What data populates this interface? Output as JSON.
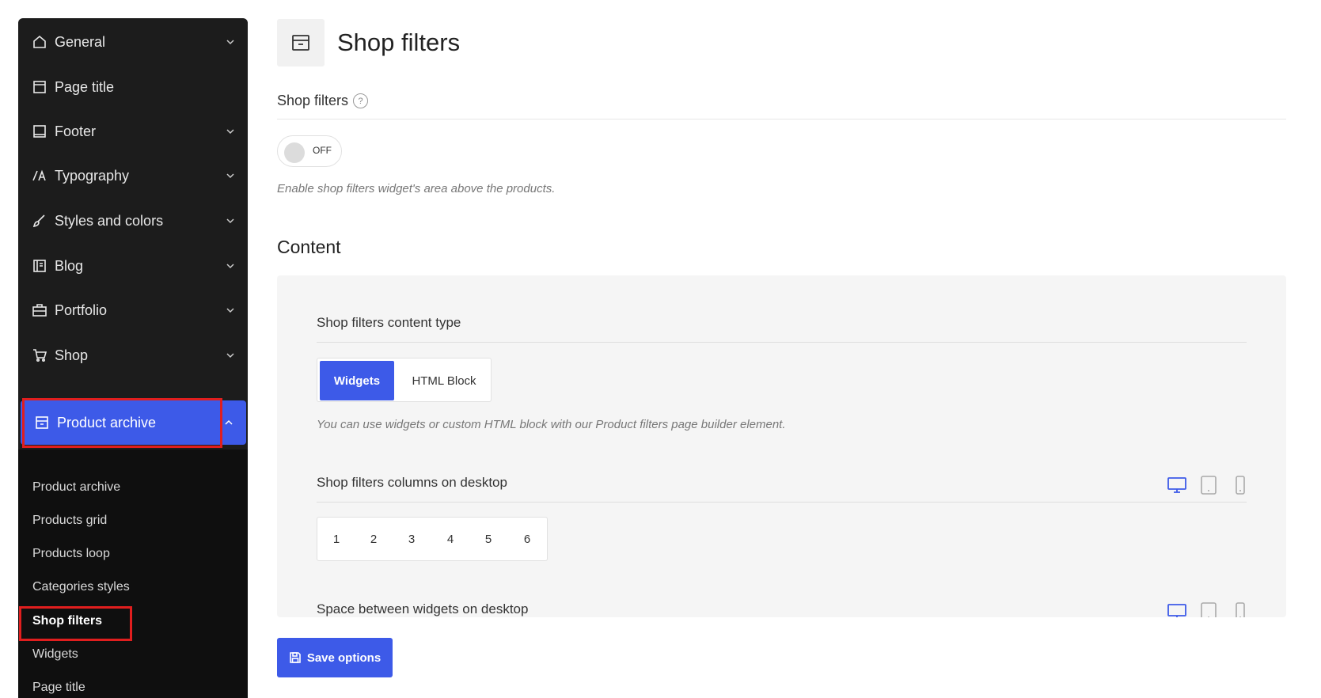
{
  "sidebar": {
    "items": [
      {
        "label": "General",
        "icon": "home-icon",
        "has_chevron": true
      },
      {
        "label": "Page title",
        "icon": "window-icon",
        "has_chevron": false
      },
      {
        "label": "Footer",
        "icon": "laptop-icon",
        "has_chevron": true
      },
      {
        "label": "Typography",
        "icon": "font-icon",
        "has_chevron": true
      },
      {
        "label": "Styles and colors",
        "icon": "brush-icon",
        "has_chevron": true
      },
      {
        "label": "Blog",
        "icon": "journal-icon",
        "has_chevron": true
      },
      {
        "label": "Portfolio",
        "icon": "briefcase-icon",
        "has_chevron": true
      },
      {
        "label": "Shop",
        "icon": "cart-icon",
        "has_chevron": true
      },
      {
        "label": "Product archive",
        "icon": "archive-icon",
        "has_chevron": true,
        "active": true
      }
    ],
    "submenu": [
      {
        "label": "Product archive"
      },
      {
        "label": "Products grid"
      },
      {
        "label": "Products loop"
      },
      {
        "label": "Categories styles"
      },
      {
        "label": "Shop filters",
        "current": true
      },
      {
        "label": "Widgets"
      },
      {
        "label": "Page title"
      }
    ]
  },
  "main": {
    "title": "Shop filters",
    "title_icon": "archive-icon",
    "shop_filters": {
      "label": "Shop filters",
      "help": "?",
      "toggle_state": "OFF",
      "description": "Enable shop filters widget's area above the products."
    },
    "content_heading": "Content",
    "content_type": {
      "label": "Shop filters content type",
      "options": [
        "Widgets",
        "HTML Block"
      ],
      "selected": "Widgets",
      "description": "You can use widgets or custom HTML block with our Product filters page builder element."
    },
    "columns": {
      "label": "Shop filters columns on desktop",
      "options": [
        "1",
        "2",
        "3",
        "4",
        "5",
        "6"
      ]
    },
    "space": {
      "label": "Space between widgets on desktop"
    },
    "save_label": "Save options"
  },
  "colors": {
    "accent": "#3d5ae8",
    "sidebar_bg": "#1c1c1c",
    "highlight": "#e01e1e"
  }
}
